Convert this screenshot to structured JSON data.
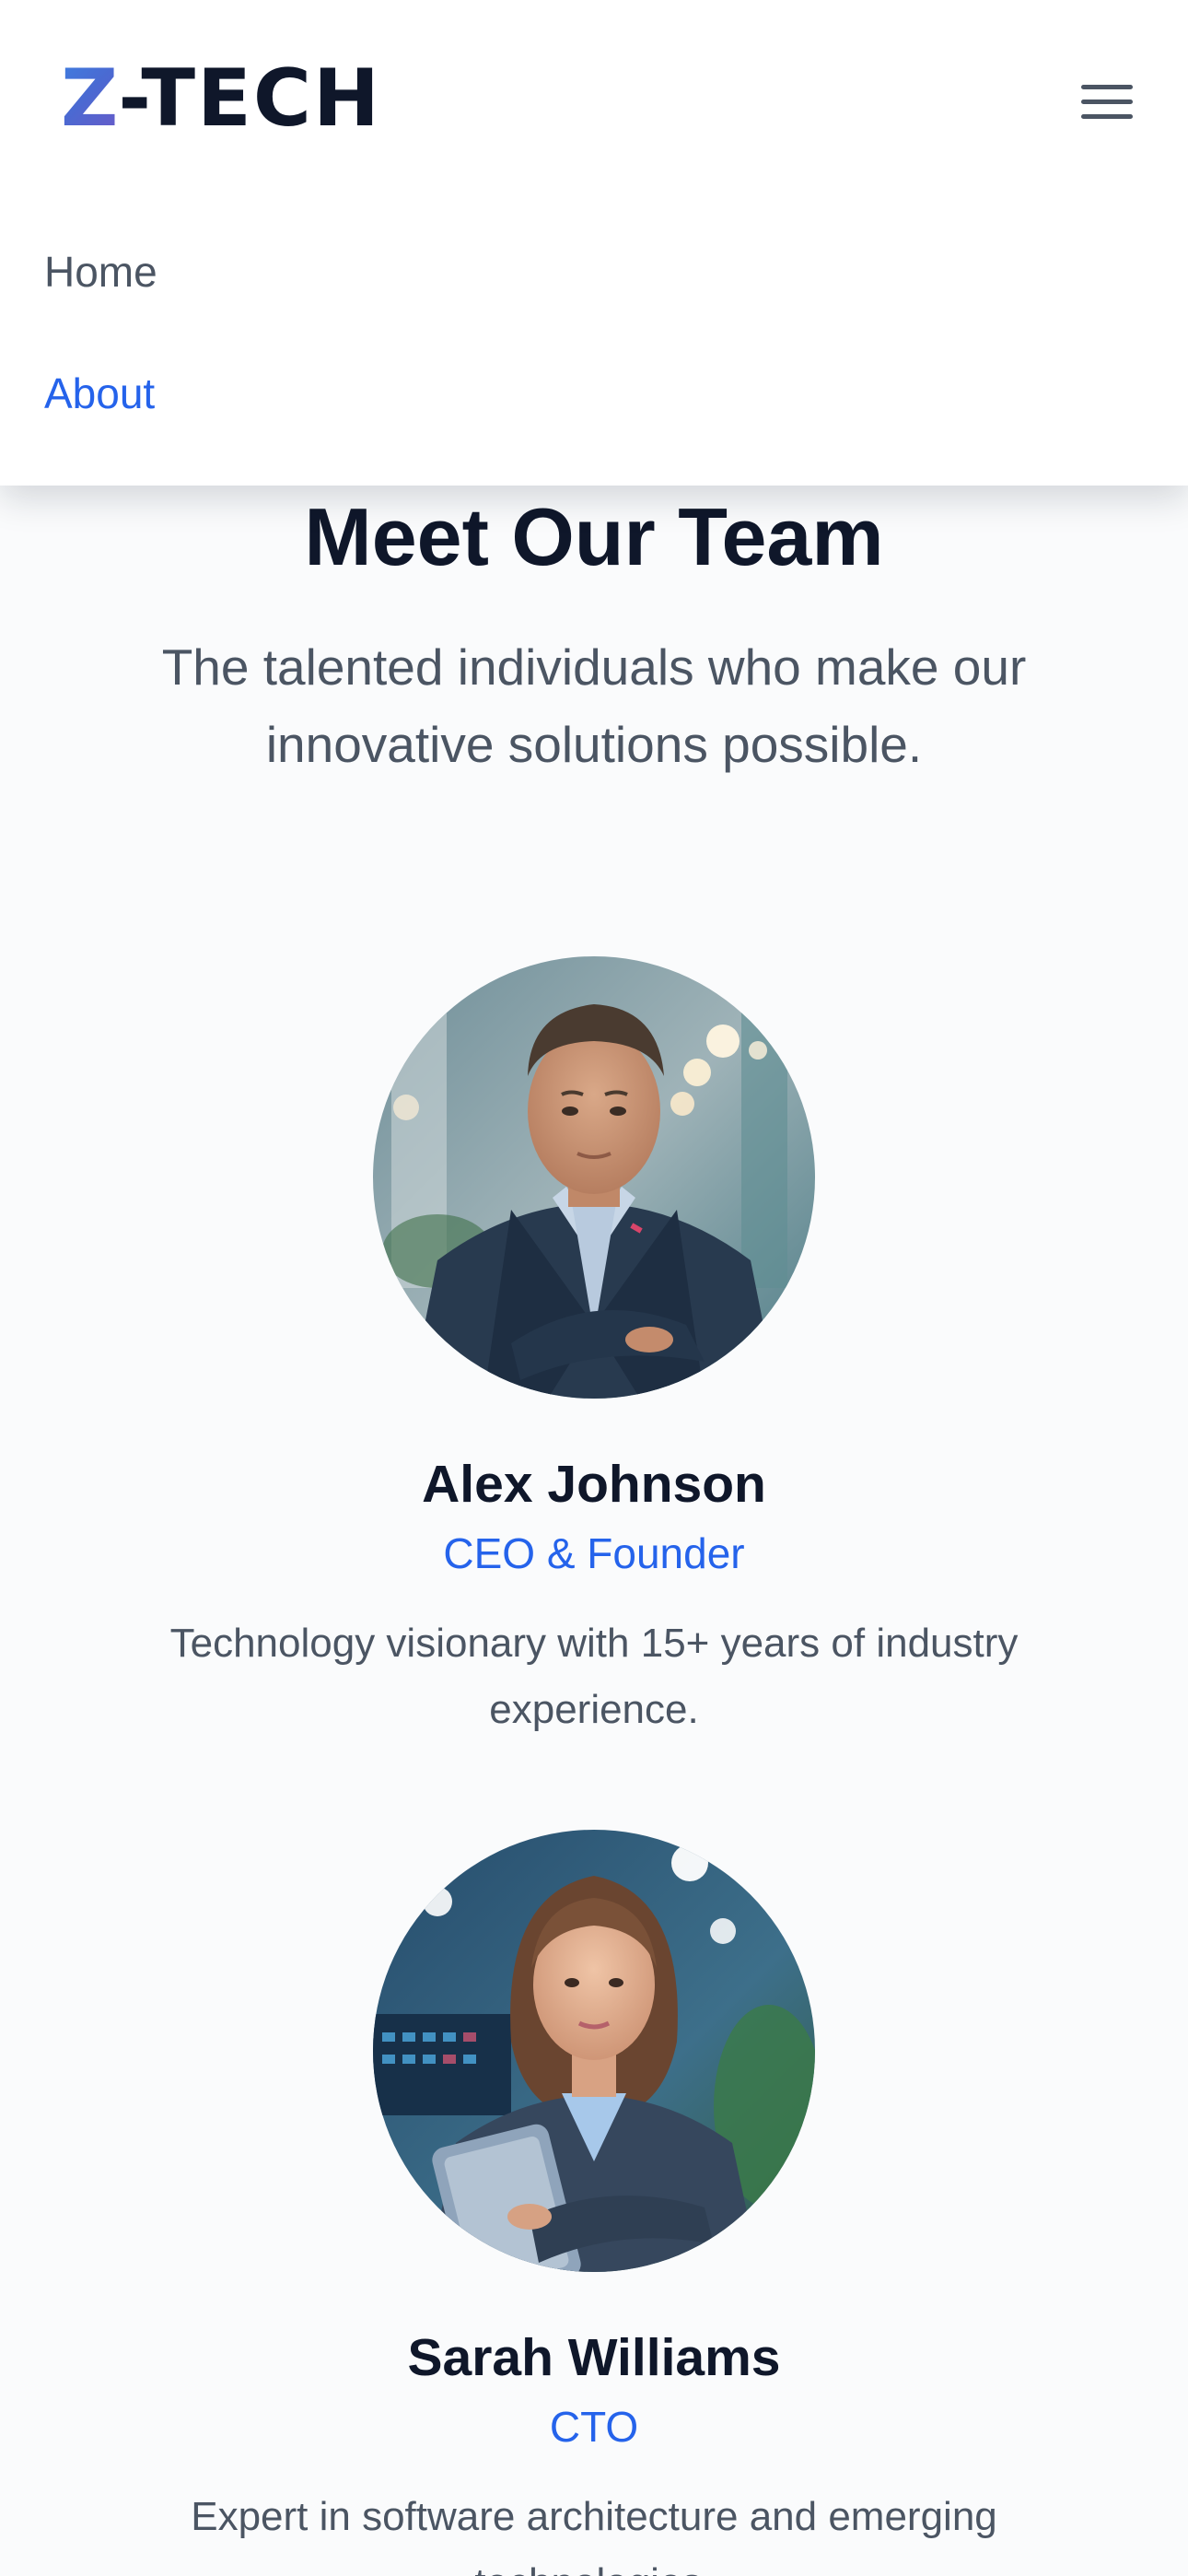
{
  "brand": {
    "logo_mark": "Z",
    "logo_text": "-TECH",
    "logo_colors": [
      "#3f7ee0",
      "#6a5ac8"
    ]
  },
  "nav": {
    "menu_icon": "hamburger-menu-icon",
    "items": [
      {
        "label": "Home",
        "active": false
      },
      {
        "label": "About",
        "active": true
      }
    ],
    "active_color": "#2563eb"
  },
  "team": {
    "title": "Meet Our Team",
    "subtitle": "The talented individuals who make our innovative solutions possible.",
    "members": [
      {
        "name": "Alex Johnson",
        "role": "CEO & Founder",
        "bio": "Technology visionary with 15+ years of industry experience."
      },
      {
        "name": "Sarah Williams",
        "role": "CTO",
        "bio": "Expert in software architecture and emerging technologies."
      }
    ]
  }
}
